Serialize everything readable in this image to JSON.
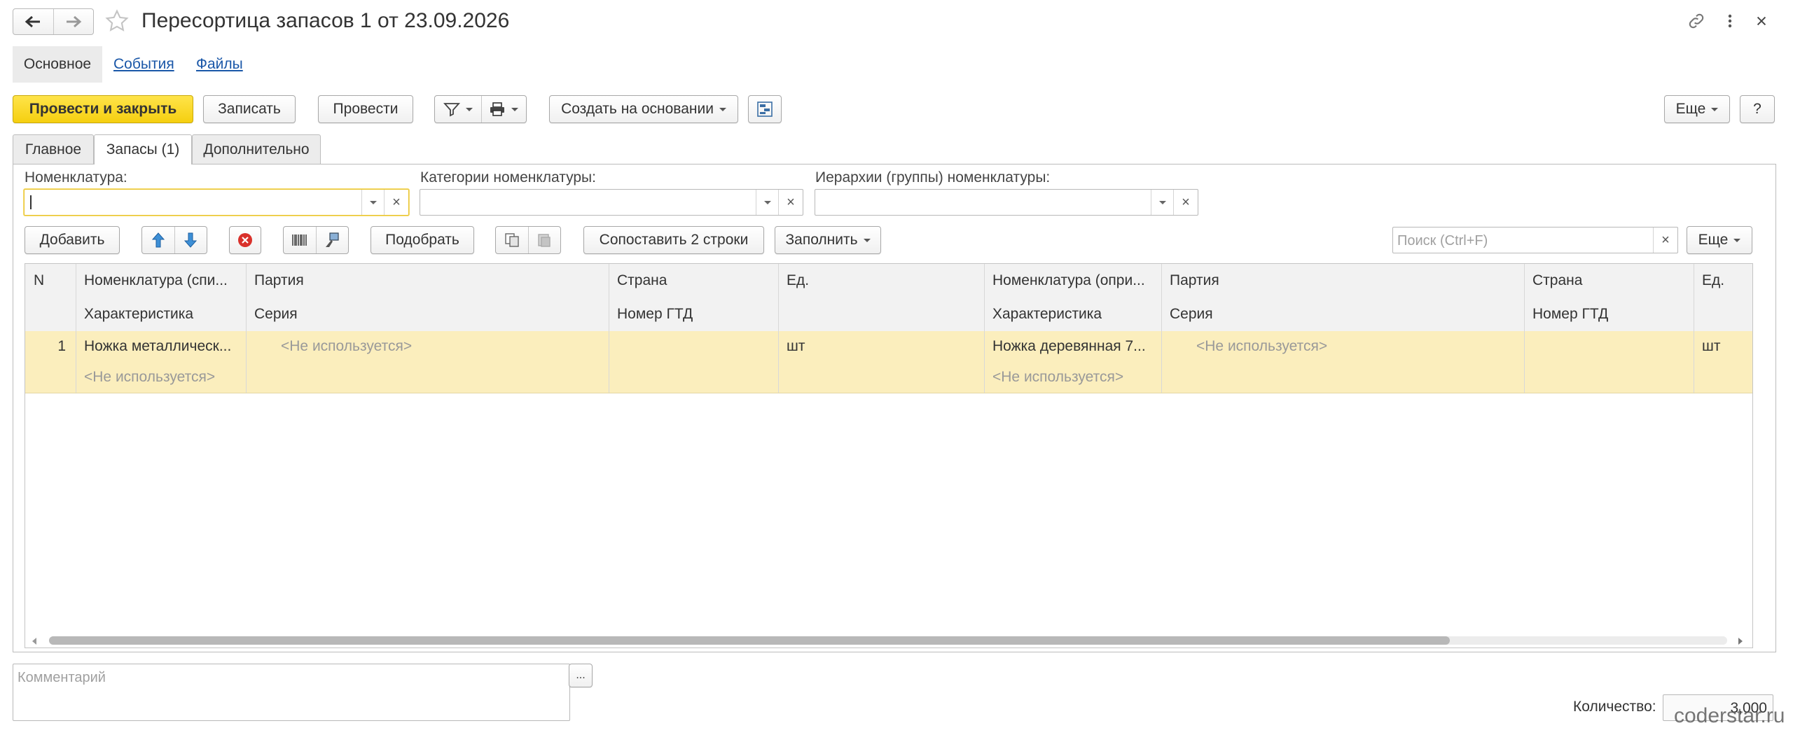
{
  "window": {
    "title": "Пересортица запасов 1 от 23.09.2026"
  },
  "nav": {
    "items": [
      "Основное",
      "События",
      "Файлы"
    ]
  },
  "toolbar": {
    "post_close": "Провести и закрыть",
    "save": "Записать",
    "post": "Провести",
    "create_based": "Создать на основании",
    "more": "Еще",
    "help": "?"
  },
  "tabs": [
    "Главное",
    "Запасы (1)",
    "Дополнительно"
  ],
  "filters": {
    "nomenclature": "Номенклатура:",
    "categories": "Категории номенклатуры:",
    "hierarchy": "Иерархии (группы) номенклатуры:"
  },
  "table_toolbar": {
    "add": "Добавить",
    "pick": "Подобрать",
    "match": "Сопоставить 2 строки",
    "fill": "Заполнить",
    "search_placeholder": "Поиск (Ctrl+F)",
    "more": "Еще"
  },
  "table": {
    "headers_top": [
      "N",
      "Номенклатура (спи...",
      "Партия",
      "Страна",
      "Ед.",
      "Номенклатура (опри...",
      "Партия",
      "Страна",
      "Ед."
    ],
    "headers_bottom": [
      "Характеристика",
      "Серия",
      "Номер ГТД",
      "Характеристика",
      "Серия",
      "Номер ГТД"
    ],
    "rows": [
      {
        "n": "1",
        "nom_from": "Ножка металлическ...",
        "batch_from": "<Не используется>",
        "unit_from": "шт",
        "char_from": "<Не используется>",
        "nom_to": "Ножка деревянная 7...",
        "batch_to": "<Не используется>",
        "unit_to": "шт",
        "char_to": "<Не используется>"
      }
    ]
  },
  "footer": {
    "comment_placeholder": "Комментарий",
    "ellipsis": "...",
    "qty_label": "Количество:",
    "qty_value": "3,000"
  },
  "watermark": "coderstar.ru",
  "colors": {
    "primary": "#f5cf10",
    "selected_row": "#fbeebd",
    "link": "#1a57a8",
    "focus": "#e8c431"
  }
}
